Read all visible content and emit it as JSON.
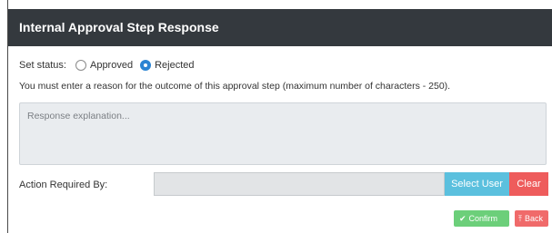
{
  "dialog": {
    "title": "Internal Approval Step Response"
  },
  "status": {
    "label": "Set status:",
    "options": [
      {
        "label": "Approved",
        "checked": false
      },
      {
        "label": "Rejected",
        "checked": true
      }
    ]
  },
  "hint": "You must enter a reason for the outcome of this approval step (maximum number of characters - 250).",
  "response": {
    "placeholder": "Response explanation..."
  },
  "action": {
    "label": "Action Required By:",
    "select_user_label": "Select User",
    "clear_label": "Clear"
  },
  "footer": {
    "confirm_label": "Confirm",
    "confirm_icon": "check-icon",
    "back_label": "Back",
    "back_icon": "back-icon"
  },
  "colors": {
    "header_bg": "#34393e",
    "select_user_bg": "#5bc0de",
    "clear_bg": "#ee5c5c",
    "confirm_bg": "#6ccf7a",
    "back_bg": "#f06a6a",
    "radio_checked": "#2b84d3"
  }
}
